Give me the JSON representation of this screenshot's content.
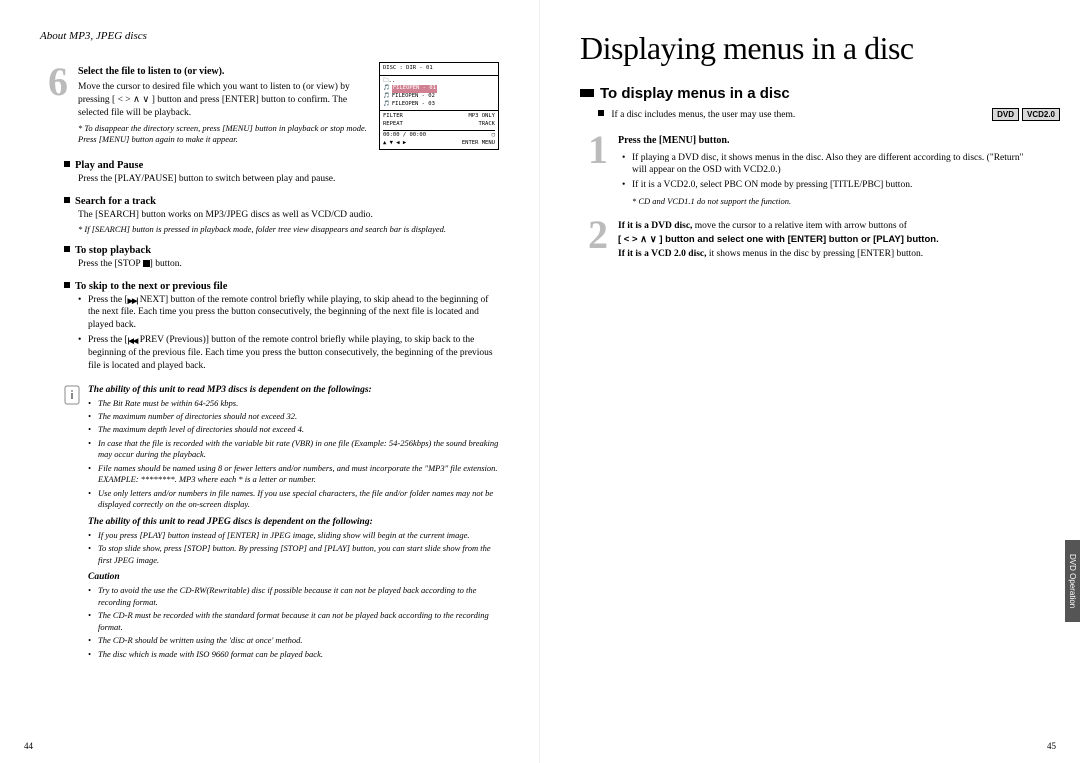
{
  "left": {
    "header": "About MP3, JPEG discs",
    "step6": {
      "num": "6",
      "title": "Select the file to listen to (or view).",
      "body": "Move the cursor to desired file which you want to listen to (or view) by pressing [ < > ∧ ∨ ] button and press [ENTER] button to confirm. The selected file will be playback.",
      "note": "* To disappear the directory screen, press [MENU] button in playback or stop mode. Press [MENU] button again to make it appear."
    },
    "osd": {
      "top": "DISC  : DIR  - 01",
      "folder": "..",
      "f1": "FILEOPEN - 01",
      "f2": "FILEOPEN - 02",
      "f3": "FILEOPEN - 03",
      "filter": "FILTER",
      "mp3only": "MP3 ONLY",
      "repeat": "REPEAT",
      "track": "TRACK",
      "time": "00:00  / 00:00",
      "enter": "ENTER MENU"
    },
    "playpause": {
      "title": "Play and Pause",
      "body": "Press the [PLAY/PAUSE] button to switch between play and pause."
    },
    "search": {
      "title": "Search for a track",
      "body": "The [SEARCH] button works on MP3/JPEG discs as well as VCD/CD audio.",
      "note": "* If [SEARCH] button is pressed in playback mode, folder tree view disappears and search bar is displayed."
    },
    "stop": {
      "title": "To stop playback",
      "body_a": "Press the [STOP ",
      "body_b": "] button."
    },
    "skip": {
      "title": "To skip to the next or previous file",
      "b1_a": "Press the [",
      "b1_mid": " NEXT] button of the remote control briefly while playing, to skip ahead to the beginning of the next file. Each time you press the button consecutively, the beginning of the next file is located and played back.",
      "b2_a": "Press the [",
      "b2_mid": " PREV (Previous)] button of the remote control briefly while playing, to skip back to the beginning of the previous file. Each time you press the button consecutively, the beginning of the previous file is located and played back."
    },
    "mp3head": "The ability of this unit to read MP3 discs is dependent on the followings:",
    "mp3list": [
      "The Bit Rate must be within 64-256 kbps.",
      "The maximum number of directories should not exceed 32.",
      "The maximum depth level of directories should not exceed 4.",
      "In case that the file is recorded with the variable bit rate (VBR) in one file (Example: 54-256kbps) the sound breaking may occur during the playback.",
      "File names should be named using 8 or fewer letters and/or numbers, and must incorporate the \"MP3\" file extension. EXAMPLE: ********. MP3 where each * is a letter or number.",
      "Use only letters and/or numbers in file names. If you use special characters, the file and/or folder names may not be displayed correctly on the on-screen display."
    ],
    "jpeghead": "The ability of this unit to read JPEG discs is dependent on the following:",
    "jpeglist": [
      "If you press [PLAY] button instead of [ENTER] in JPEG image, sliding show will begin at the current image.",
      "To stop slide show, press [STOP] button. By pressing [STOP] and [PLAY] button, you can start slide show from the first JPEG image."
    ],
    "caution": "Caution",
    "cautionlist": [
      "Try to avoid the use the CD-RW(Rewritable) disc if possible because it can not be played back according to the recording format.",
      "The CD-R must be recorded with the standard format because it can not be played back according to the recording format.",
      "The CD-R should be written using the 'disc at once' method.",
      "The disc which is made with ISO 9660 format can be played back."
    ],
    "pagenum": "44"
  },
  "right": {
    "title": "Displaying menus in a disc",
    "subtitle": "To display menus in a disc",
    "badges": {
      "a": "DVD",
      "b": "VCD2.0"
    },
    "intro": "If a disc includes menus, the user may use them.",
    "step1": {
      "num": "1",
      "title": "Press the [MENU] button.",
      "b1": "If playing a DVD disc, it shows menus in the disc. Also they are different according to discs. (\"Return\" will appear on the OSD with VCD2.0.)",
      "b2": "If it is a VCD2.0, select PBC ON mode by pressing [TITLE/PBC] button.",
      "note": "* CD and VCD1.1 do not support the function."
    },
    "step2": {
      "num": "2",
      "l1a": "If it is a DVD disc,",
      "l1b": " move the cursor to a relative item with arrow buttons of",
      "l2": "[ < > ∧ ∨ ] button and select one with [ENTER] button or [PLAY] button.",
      "l3a": "If it is a VCD 2.0 disc,",
      "l3b": " it shows menus in the disc by pressing [ENTER] button."
    },
    "tab": "DVD Operation",
    "pagenum": "45"
  }
}
